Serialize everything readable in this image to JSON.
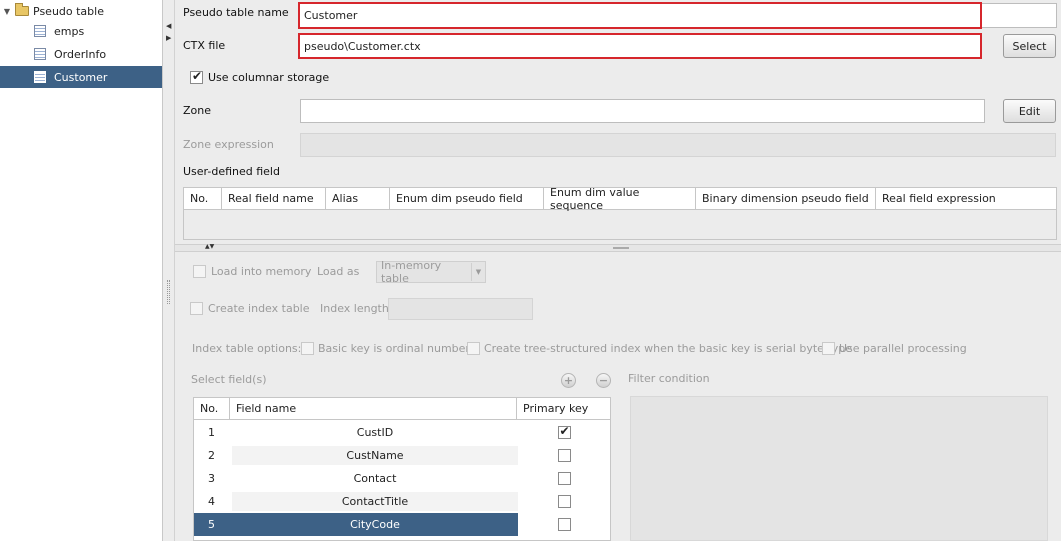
{
  "tree": {
    "root": "Pseudo table",
    "items": [
      {
        "label": "emps"
      },
      {
        "label": "OrderInfo"
      },
      {
        "label": "Customer"
      }
    ]
  },
  "form": {
    "pseudo_table_name_label": "Pseudo table name",
    "pseudo_table_name_value": "Customer",
    "ctx_file_label": "CTX file",
    "ctx_file_value": "pseudo\\Customer.ctx",
    "select_button": "Select",
    "use_columnar_label": "Use columnar storage",
    "use_columnar_checked": true,
    "zone_label": "Zone",
    "zone_value": "",
    "edit_button": "Edit",
    "zone_expression_label": "Zone expression",
    "user_defined_field_label": "User-defined field"
  },
  "udf_table": {
    "headers": [
      "No.",
      "Real field name",
      "Alias",
      "Enum dim pseudo field",
      "Enum dim value sequence",
      "Binary dimension pseudo field",
      "Real field expression"
    ]
  },
  "lower": {
    "load_into_memory": "Load into memory",
    "load_as_label": "Load as",
    "load_as_value": "In-memory table",
    "create_index_table": "Create index table",
    "index_length_label": "Index length",
    "index_table_options_label": "Index table options:",
    "opt_basic_key": "Basic key is ordinal number",
    "opt_tree_index": "Create tree-structured index when the basic key is serial byte type",
    "opt_parallel": "Use parallel processing",
    "select_fields_label": "Select field(s)",
    "add_symbol": "+",
    "remove_symbol": "−",
    "filter_condition_label": "Filter condition"
  },
  "field_table": {
    "headers": [
      "No.",
      "Field name",
      "Primary key"
    ],
    "rows": [
      {
        "no": "1",
        "name": "CustID",
        "pk": true
      },
      {
        "no": "2",
        "name": "CustName",
        "pk": false
      },
      {
        "no": "3",
        "name": "Contact",
        "pk": false
      },
      {
        "no": "4",
        "name": "ContactTitle",
        "pk": false
      },
      {
        "no": "5",
        "name": "CityCode",
        "pk": false
      }
    ],
    "selected_row": 5
  },
  "colors": {
    "selection": "#3d6186",
    "highlight_border": "#d6262c"
  }
}
